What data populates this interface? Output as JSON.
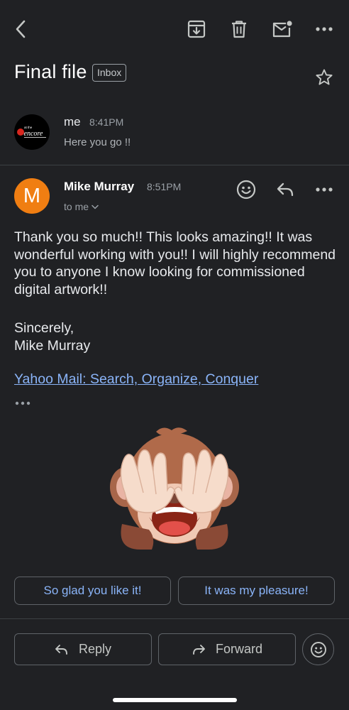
{
  "toolbar": {
    "back_icon": "chevron-left-icon",
    "archive_icon": "archive-icon",
    "delete_icon": "trash-icon",
    "mark_unread_icon": "mail-unread-icon",
    "more_icon": "more-horizontal-icon"
  },
  "header": {
    "subject": "Final file",
    "label": "Inbox",
    "star_icon": "star-icon"
  },
  "messages": [
    {
      "sender": "me",
      "time": "8:41PM",
      "snippet": "Here you go !!",
      "avatar": "encore logo",
      "avatar_text": "at the encore"
    },
    {
      "sender": "Mike Murray",
      "initial": "M",
      "avatar_color": "#f07e12",
      "time": "8:51PM",
      "recipient": "to me",
      "body_paragraph": "Thank you so much!!  This looks amazing!!  It was wonderful working with you!!  I will highly recommend you to anyone I know looking for commissioned digital artwork!!",
      "signoff_line1": "Sincerely,",
      "signoff_line2": "Mike Murray",
      "link_text": "Yahoo Mail: Search, Organize, Conquer",
      "emoji": "see-no-evil-monkey"
    }
  ],
  "smart_replies": [
    "So glad you like it!",
    "It was my pleasure!"
  ],
  "actions": {
    "reply": "Reply",
    "forward": "Forward"
  },
  "colors": {
    "background": "#202124",
    "link": "#8ab4f8",
    "avatar_orange": "#f07e12"
  }
}
